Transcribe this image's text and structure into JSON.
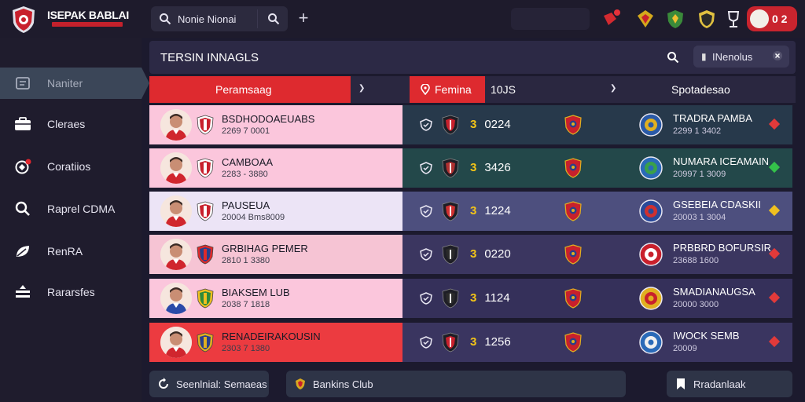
{
  "app": {
    "title": "ISEPAK BABLAI"
  },
  "topbar": {
    "search_text": "Nonie Nionai",
    "badge_count": "0 2"
  },
  "sidebar": {
    "items": [
      {
        "label": "Naniter",
        "icon": "list-icon"
      },
      {
        "label": "Cleraes",
        "icon": "briefcase-icon"
      },
      {
        "label": "Coratiios",
        "icon": "ball-icon"
      },
      {
        "label": "Raprel CDMA",
        "icon": "search-icon"
      },
      {
        "label": "RenRA",
        "icon": "leaf-icon"
      },
      {
        "label": "Rararsfes",
        "icon": "stack-icon"
      }
    ]
  },
  "panel": {
    "title": "TERSIN INNAGLS",
    "filter_label": "INenolus"
  },
  "columns": {
    "a": "Peramsaag",
    "b": "Femina",
    "c": "10JS",
    "d": "Spotadesao"
  },
  "rows": [
    {
      "name": "BSDHODOAEUABS",
      "sub": "2269 7 0001",
      "num": "3",
      "value": "0224",
      "club": "TRADRA PAMBA",
      "club_sub": "2299 1 3402",
      "trend_color": "#e23a3a",
      "left_bg": "#fbc6dc"
    },
    {
      "name": "CAMBOAA",
      "sub": "2283 - 3880",
      "num": "3",
      "value": "3426",
      "club": "NUMARA ICEAMAIN",
      "club_sub": "20997 1 3009",
      "trend_color": "#34c24a",
      "left_bg": "#fbc6dc"
    },
    {
      "name": "PAUSEUA",
      "sub": "20004 Bms8009",
      "num": "3",
      "value": "1224",
      "club": "GSEBEIA CDASKII",
      "club_sub": "20003 1 3004",
      "trend_color": "#f0c020",
      "left_bg": "#ece4f6"
    },
    {
      "name": "GRBIHAG PEMER",
      "sub": "2810 1 3380",
      "num": "3",
      "value": "0220",
      "club": "PRBBRD BOFURSIR",
      "club_sub": "23688 1600",
      "trend_color": "#e23a3a",
      "left_bg": "#f6c4d4"
    },
    {
      "name": "BIAKSEM LUB",
      "sub": "2038 7 1818",
      "num": "3",
      "value": "1124",
      "club": "SMADIANAUGSA",
      "club_sub": "20000 3000",
      "trend_color": "#e23a3a",
      "left_bg": "#fbc6dc"
    },
    {
      "name": "RENADEIRAKOUSIN",
      "sub": "2303 7 1380",
      "num": "3",
      "value": "1256",
      "club": "IWOCK SEMB",
      "club_sub": "20009",
      "trend_color": "#e23a3a",
      "left_bg": "#ec3b40"
    }
  ],
  "footer": {
    "btn1": "Seenlnial: Semaeas",
    "btn2": "Bankins Club",
    "btn3": "Rradanlaak"
  },
  "colors": {
    "accent": "#de2a2f",
    "panel": "#2c2945"
  }
}
